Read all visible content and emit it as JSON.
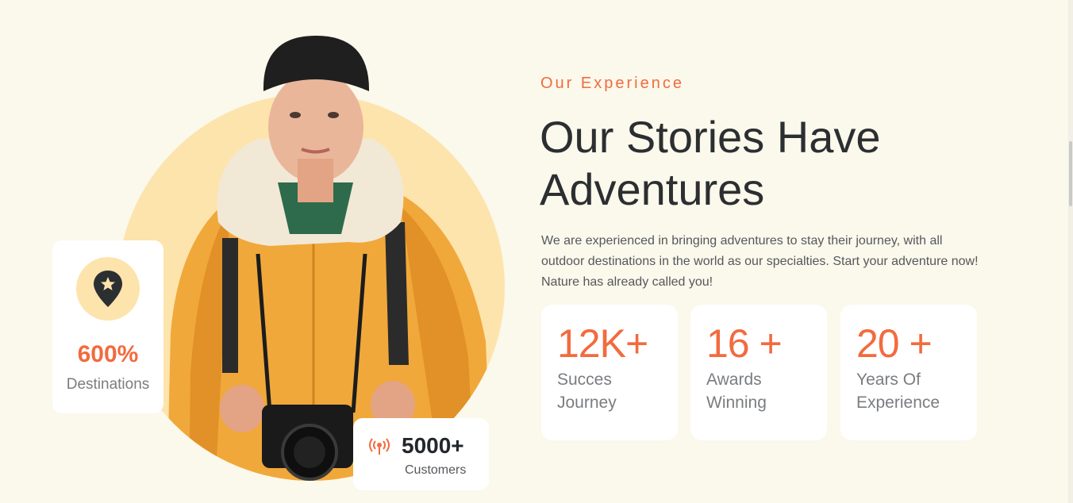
{
  "section": {
    "eyebrow": "Our Experience",
    "heading": "Our Stories Have Adventures",
    "description": "We are experienced in bringing adventures to stay their journey, with all outdoor destinations in the world as our specialties. Start your adventure now! Nature has already called you!"
  },
  "stats": [
    {
      "value": "12K+",
      "label": "Succes Journey"
    },
    {
      "value": "16 +",
      "label": "Awards Winning"
    },
    {
      "value": "20 +",
      "label": "Years Of Experience"
    }
  ],
  "destinations_card": {
    "icon": "map-pin-star-icon",
    "value": "600%",
    "label": "Destinations"
  },
  "customers_card": {
    "icon": "broadcast-icon",
    "value": "5000+",
    "label": "Customers"
  },
  "colors": {
    "accent": "#f26b3e",
    "background": "#fbf8ec",
    "circle": "#fde4ac",
    "jacket": "#f1a83a"
  }
}
